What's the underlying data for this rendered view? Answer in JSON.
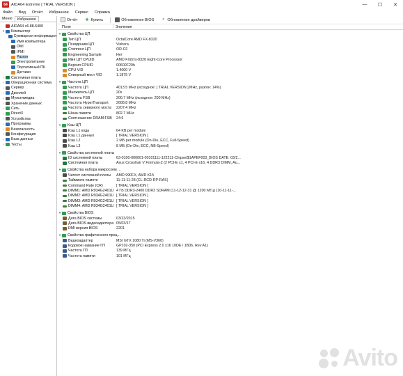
{
  "window": {
    "title": "AIDA64 Extreme  [ TRIAL VERSION ]",
    "logo_text": "64",
    "controls": [
      "—",
      "☐",
      "✕"
    ]
  },
  "menu": [
    "Файл",
    "Вид",
    "Отчёт",
    "Избранное",
    "Сервис",
    "Справка"
  ],
  "left_panel": {
    "tabs": [
      "Меню",
      "Избранное"
    ],
    "tree": [
      {
        "label": "AIDA64 v6.88.6400",
        "level": 0,
        "exp": "",
        "icon": "#c62828"
      },
      {
        "label": "Компьютер",
        "level": 0,
        "exp": "▾",
        "icon": "#2b6cb0"
      },
      {
        "label": "Суммарная информация",
        "level": 1,
        "exp": "",
        "icon": "#2b6cb0"
      },
      {
        "label": "Имя компьютера",
        "level": 1,
        "exp": "",
        "icon": "#2b6cb0"
      },
      {
        "label": "DMI",
        "level": 1,
        "exp": "",
        "icon": "#555"
      },
      {
        "label": "IPMI",
        "level": 1,
        "exp": "",
        "icon": "#555"
      },
      {
        "label": "Разгон",
        "level": 1,
        "exp": "",
        "icon": "#e08a1e",
        "selected": true
      },
      {
        "label": "Электропитание",
        "level": 1,
        "exp": "",
        "icon": "#2e9e4f"
      },
      {
        "label": "Портативный ПК",
        "level": 1,
        "exp": "",
        "icon": "#2b6cb0"
      },
      {
        "label": "Датчики",
        "level": 1,
        "exp": "",
        "icon": "#e08a1e"
      },
      {
        "label": "Системная плата",
        "level": 0,
        "exp": "›",
        "icon": "#1f7a3f"
      },
      {
        "label": "Операционная система",
        "level": 0,
        "exp": "›",
        "icon": "#2b6cb0"
      },
      {
        "label": "Сервер",
        "level": 0,
        "exp": "›",
        "icon": "#555"
      },
      {
        "label": "Дисплей",
        "level": 0,
        "exp": "›",
        "icon": "#2b6cb0"
      },
      {
        "label": "Мультимедиа",
        "level": 0,
        "exp": "›",
        "icon": "#555"
      },
      {
        "label": "Хранение данных",
        "level": 0,
        "exp": "›",
        "icon": "#555"
      },
      {
        "label": "Сеть",
        "level": 0,
        "exp": "›",
        "icon": "#2e9e4f"
      },
      {
        "label": "DirectX",
        "level": 0,
        "exp": "›",
        "icon": "#2e9e4f"
      },
      {
        "label": "Устройства",
        "level": 0,
        "exp": "›",
        "icon": "#555"
      },
      {
        "label": "Программы",
        "level": 0,
        "exp": "›",
        "icon": "#2b6cb0"
      },
      {
        "label": "Безопасность",
        "level": 0,
        "exp": "›",
        "icon": "#e08a1e"
      },
      {
        "label": "Конфигурация",
        "level": 0,
        "exp": "›",
        "icon": "#555"
      },
      {
        "label": "База данных",
        "level": 0,
        "exp": "›",
        "icon": "#2b6cb0"
      },
      {
        "label": "Тесты",
        "level": 0,
        "exp": "›",
        "icon": "#2e9e4f"
      }
    ]
  },
  "toolbar": {
    "report": "Отчёт",
    "buy": "Купить",
    "bios_update": "Обновления BIOS",
    "driver_update": "Обновления драйверов"
  },
  "columns": {
    "field": "Поле",
    "value": "Значение"
  },
  "sections": [
    {
      "title": "Свойства ЦП",
      "rows": [
        {
          "f": "Тип ЦП",
          "v": "OctalCore AMD FX-8320",
          "icon": "green"
        },
        {
          "f": "Псевдоним ЦП",
          "v": "Vishera",
          "icon": "green"
        },
        {
          "f": "Степпинг ЦП",
          "v": "OR-C0",
          "icon": "green"
        },
        {
          "f": "Engineering Sample",
          "v": "Нет",
          "icon": "green"
        },
        {
          "f": "Имя ЦП CPUID",
          "v": "AMD FX(tm)-8320 Eight-Core Processor",
          "icon": "green"
        },
        {
          "f": "Версия CPUID",
          "v": "00600F20h",
          "icon": "green"
        },
        {
          "f": "CPU VID",
          "v": "1.4000 V",
          "icon": "orange"
        },
        {
          "f": "Северный мост VID",
          "v": "1.1875 V",
          "icon": "orange"
        }
      ]
    },
    {
      "title": "Частота ЦП",
      "rows": [
        {
          "f": "Частота ЦП",
          "v": "4013.5 MHz  (исходное: [ TRIAL VERSION ] MHz, разгон: 14%)",
          "icon": "green"
        },
        {
          "f": "Множитель ЦП",
          "v": "20x",
          "icon": "green"
        },
        {
          "f": "Частота FSB",
          "v": "200.7 MHz  (исходное: 200 MHz)",
          "icon": "green"
        },
        {
          "f": "Частота HyperTransport",
          "v": "2608.8 MHz",
          "icon": "green"
        },
        {
          "f": "Частота северного моста",
          "v": "2207.4 MHz",
          "icon": "green"
        },
        {
          "f": "Шина памяти",
          "v": "802.7 MHz",
          "icon": "ram"
        },
        {
          "f": "Соотношение DRAM:FSB",
          "v": "24:6",
          "icon": "ram"
        }
      ]
    },
    {
      "title": "Кэш ЦП",
      "rows": [
        {
          "f": "Кэш L1 кода",
          "v": "64 KB per module",
          "icon": "chip"
        },
        {
          "f": "Кэш L1 данных",
          "v": "[ TRIAL VERSION ]",
          "icon": "chip"
        },
        {
          "f": "Кэш L2",
          "v": "2 МБ per module  (On-Die, ECC, Full-Speed)",
          "icon": "chip"
        },
        {
          "f": "Кэш L3",
          "v": "8 МБ  (On-Die, ECC, NB-Speed)",
          "icon": "chip"
        }
      ]
    },
    {
      "title": "Свойства системной платы",
      "rows": [
        {
          "f": "ID системной платы",
          "v": "63-0100-000001-00101111-122211-Chipset$1APEF003_BIOS DATE: 03/2...",
          "icon": "board"
        },
        {
          "f": "Системная плата",
          "v": "Asus Crosshair V Formula-Z  (2 PCI-E x1, 4 PCI-E x16, 4 DDR3 DIMM, Au...",
          "icon": "board"
        }
      ]
    },
    {
      "title": "Свойства набора микросхем ...",
      "rows": [
        {
          "f": "Чипсет системной платы",
          "v": "AMD 990FX, AMD K15",
          "icon": "chip"
        },
        {
          "f": "Тайминги памяти",
          "v": "11-11-11-28  (CL-RCD-RP-RAS)",
          "icon": "ram"
        },
        {
          "f": "Command Rate (CR)",
          "v": "[ TRIAL VERSION ]",
          "icon": "ram"
        },
        {
          "f": "DIMM1: AMD R934G2401U1S",
          "v": "4 ГБ DDR3-2400 DDR3 SDRAM  (11-12-12-31 @ 1200 МГц)  (10-11-11-...",
          "icon": "ram"
        },
        {
          "f": "DIMM2: AMD R934G2401U1S",
          "v": "[ TRIAL VERSION ]",
          "icon": "ram"
        },
        {
          "f": "DIMM3: AMD R934G2401U1S",
          "v": "[ TRIAL VERSION ]",
          "icon": "ram"
        },
        {
          "f": "DIMM4: AMD R934G2401U1S",
          "v": "[ TRIAL VERSION ]",
          "icon": "ram"
        }
      ]
    },
    {
      "title": "Свойства BIOS",
      "rows": [
        {
          "f": "Дата BIOS системы",
          "v": "03/23/2015",
          "icon": "bios"
        },
        {
          "f": "Дата BIOS видеоадаптера",
          "v": "05/03/17",
          "icon": "bios"
        },
        {
          "f": "DMI версия BIOS",
          "v": "2201",
          "icon": "bios"
        }
      ]
    },
    {
      "title": "Свойства графического проц...",
      "rows": [
        {
          "f": "Видеоадаптер",
          "v": "MSI GTX 1080 Ti (MS-V360)",
          "icon": "gpu"
        },
        {
          "f": "Кодовое название ГП",
          "v": "GP102-350  (PCI Express 2.0 x16 10DE / 1B06, Rev A1)",
          "icon": "gpu"
        },
        {
          "f": "Частота ГП",
          "v": "139 МГц",
          "icon": "gpu"
        },
        {
          "f": "Частота памяти",
          "v": "101 МГц",
          "icon": "gpu"
        }
      ]
    }
  ],
  "watermark": {
    "text": "Avito"
  }
}
